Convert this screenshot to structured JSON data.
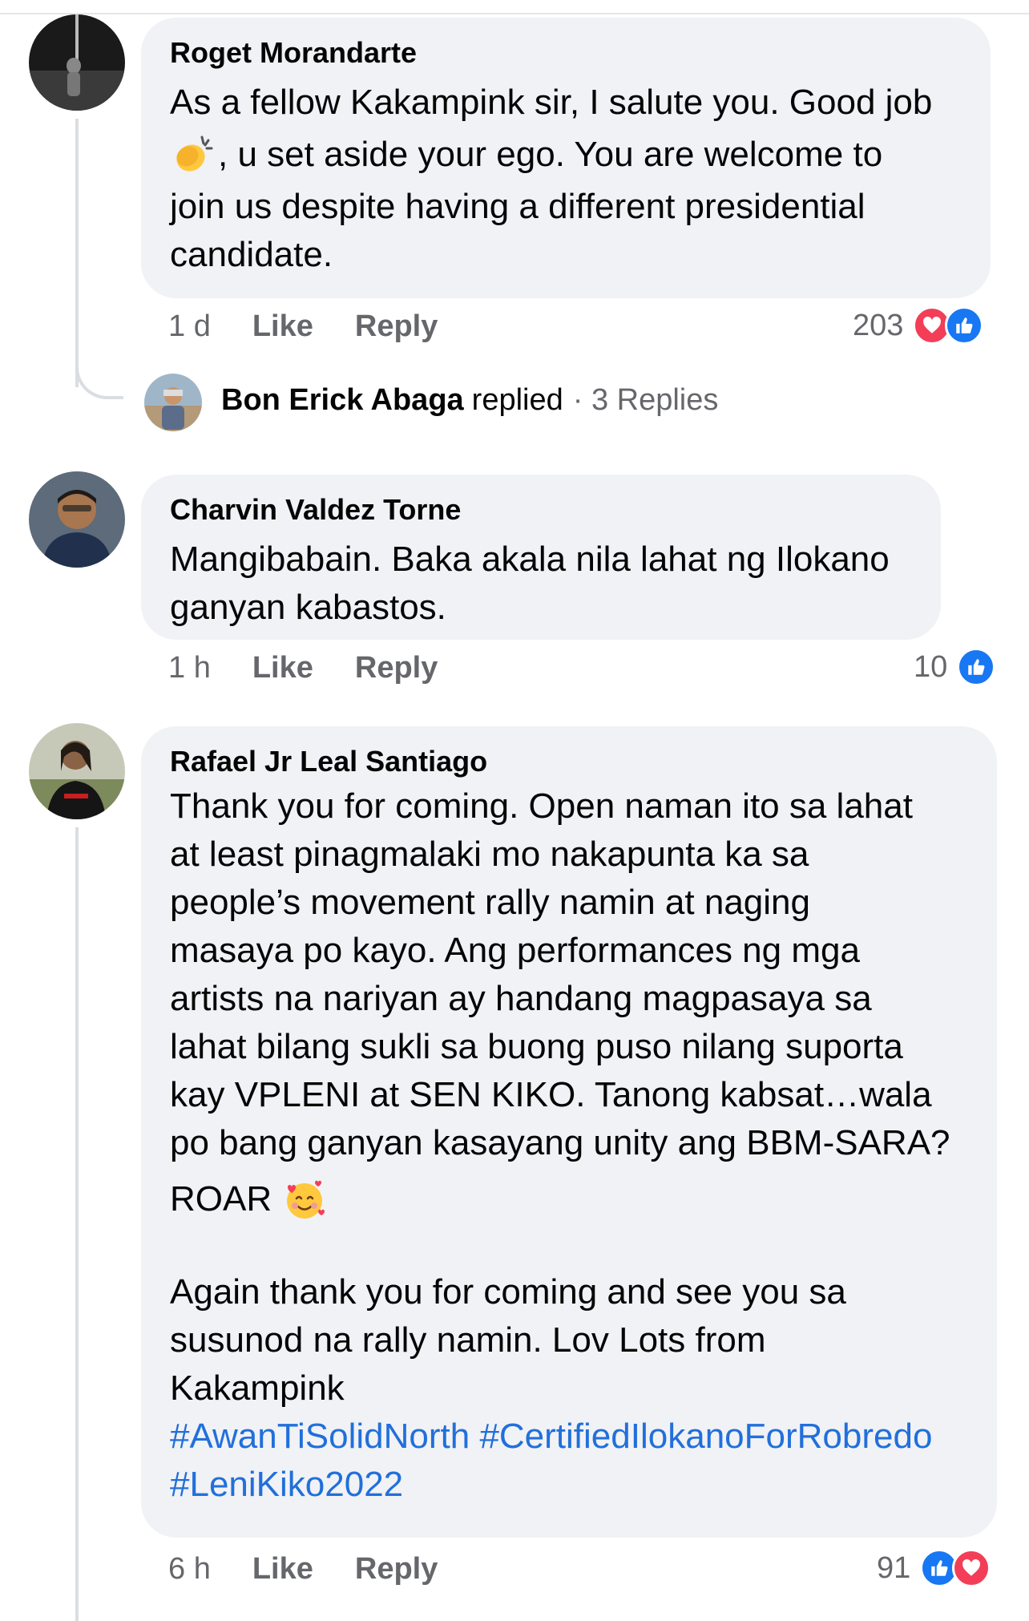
{
  "comments": [
    {
      "author": "Roget Morandarte",
      "lines": [
        "As a fellow Kakampink sir, I salute you. Good job",
        ",  u set aside your ego. You are welcome to",
        "join us despite having a different presidential",
        "candidate."
      ],
      "emoji": "clapping-hands",
      "time": "1 d",
      "like_label": "Like",
      "reply_label": "Reply",
      "reaction_count": "203",
      "reactions": [
        "love",
        "like"
      ]
    },
    {
      "author": "Charvin Valdez Torne",
      "lines": [
        "Mangibabain. Baka akala nila lahat ng Ilokano",
        "ganyan kabastos."
      ],
      "time": "1 h",
      "like_label": "Like",
      "reply_label": "Reply",
      "reaction_count": "10",
      "reactions": [
        "like"
      ]
    },
    {
      "author": "Rafael Jr Leal Santiago",
      "lines": [
        "Thank you for coming. Open naman ito sa lahat",
        "at least pinagmalaki mo nakapunta ka sa",
        "people’s movement rally namin at naging",
        "masaya po kayo. Ang performances ng mga",
        "artists na nariyan ay handang magpasaya sa",
        "lahat bilang sukli sa buong puso nilang suporta",
        "kay VPLENI at SEN KIKO. Tanong kabsat…wala",
        "po bang ganyan kasayang unity ang BBM-SARA?",
        "ROAR",
        "",
        "Again thank you for coming and see you sa",
        "susunod na rally namin. Lov Lots from",
        "Kakampink"
      ],
      "hashtags": [
        "#AwanTiSolidNorth",
        "#CertifiedIlokanoForRobredo",
        "#LeniKiko2022"
      ],
      "emoji": "smiling-face-with-hearts",
      "time": "6 h",
      "like_label": "Like",
      "reply_label": "Reply",
      "reaction_count": "91",
      "reactions": [
        "like",
        "love"
      ]
    }
  ],
  "reply_preview": {
    "name": "Bon Erick Abaga",
    "verb": "replied",
    "count": "· 3 Replies"
  },
  "colors": {
    "bubble": "#f0f2f5",
    "meta_text": "#65676b",
    "hashtag": "#216fdb",
    "like": "#1877f2",
    "love": "#f33e58"
  }
}
